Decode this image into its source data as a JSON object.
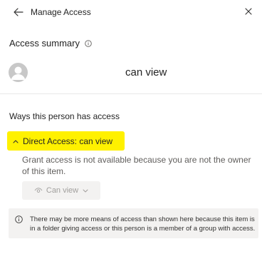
{
  "header": {
    "title": "Manage Access",
    "back_icon": "arrow-left-icon",
    "close_icon": "close-icon"
  },
  "summary": {
    "title": "Access summary",
    "info_icon": "info-icon",
    "permission": "can view"
  },
  "ways": {
    "title": "Ways this person has access",
    "direct_access_label": "Direct Access: can view",
    "grant_message": "Grant access is not available because you are not the owner of this item.",
    "permission_button_label": "Can view",
    "highlight_color": "#fff100"
  },
  "notice": {
    "text": "There may be more means of access than shown here because this item is in a folder giving access or this person is a member of a group with access."
  }
}
